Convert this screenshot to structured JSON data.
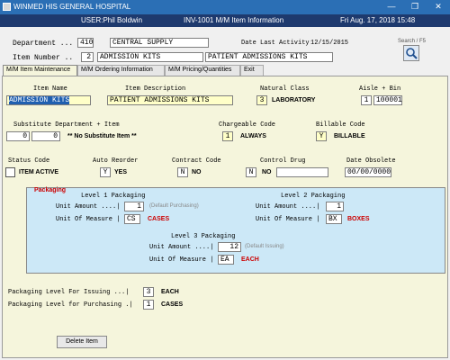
{
  "window": {
    "title": "WINMED HIS GENERAL HOSPITAL",
    "minimize": "—",
    "maximize": "❐",
    "close": "✕"
  },
  "info": {
    "user": "USER:Phil Boldwin",
    "screen": "INV-1001   M/M Item Information",
    "datetime": "Fri Aug. 17, 2018 15:48"
  },
  "header": {
    "department_label": "Department ...",
    "department_code": "410",
    "department_name": "CENTRAL SUPPLY",
    "date_last_activity_label": "Date Last Activity",
    "date_last_activity": "12/15/2015",
    "item_number_label": "Item Number ..",
    "item_number": "2",
    "item_short": "ADMISSION KITS",
    "item_long": "PATIENT ADMISSIONS KITS",
    "search_label": "Search / F5"
  },
  "tabs": [
    {
      "label": "M/M Item Maintenance"
    },
    {
      "label": "M/M Ordering Information"
    },
    {
      "label": "M/M Pricing/Quantities"
    },
    {
      "label": "Exit"
    }
  ],
  "item": {
    "item_name_label": "Item Name",
    "item_name": "ADMISSION KITS",
    "item_description_label": "Item Description",
    "item_description": "PATIENT ADMISSIONS KITS",
    "natural_class_label": "Natural Class",
    "natural_class_code": "3",
    "natural_class_name": "LABORATORY",
    "aisle_bin_label": "Aisle + Bin",
    "aisle": "1",
    "bin": "100001",
    "substitute_label": "Substitute Department + Item",
    "sub_dept": "0",
    "sub_item": "0",
    "sub_text": "** No Substitute Item **",
    "chargeable_label": "Chargeable Code",
    "chargeable_code": "1",
    "chargeable_text": "ALWAYS",
    "billable_label": "Billable Code",
    "billable_code": "Y",
    "billable_text": "BILLABLE",
    "status_label": "Status Code",
    "status_text": "ITEM ACTIVE",
    "auto_reorder_label": "Auto Reorder",
    "auto_reorder_code": "Y",
    "auto_reorder_text": "YES",
    "contract_label": "Contract Code",
    "contract_code": "N",
    "contract_text": "NO",
    "control_drug_label": "Control Drug",
    "control_drug_code": "N",
    "control_drug_text": "NO",
    "date_obsolete_label": "Date Obsolete",
    "date_obsolete": "00/00/0000"
  },
  "packaging": {
    "title": "Packaging",
    "l1_title": "Level 1 Packaging",
    "l1_unit_amount_label": "Unit Amount ....|",
    "l1_unit_amount": "1",
    "l1_hint": "(Default Purchasing)",
    "l1_uom_label": "Unit Of Measure |",
    "l1_uom": "CS",
    "l1_uom_text": "CASES",
    "l2_title": "Level 2 Packaging",
    "l2_unit_amount_label": "Unit Amount ....|",
    "l2_unit_amount": "1",
    "l2_uom_label": "Unit Of Measure |",
    "l2_uom": "BX",
    "l2_uom_text": "BOXES",
    "l3_title": "Level 3 Packaging",
    "l3_unit_amount_label": "Unit Amount ....|",
    "l3_unit_amount": "12",
    "l3_hint": "(Default Issuing)",
    "l3_uom_label": "Unit Of Measure |",
    "l3_uom": "EA",
    "l3_uom_text": "EACH"
  },
  "levels": {
    "issuing_label": "Packaging Level For Issuing  ...|",
    "issuing_value": "3",
    "issuing_text": "EACH",
    "purchasing_label": "Packaging Level for Purchasing .|",
    "purchasing_value": "1",
    "purchasing_text": "CASES"
  },
  "delete_button": "Delete Item"
}
